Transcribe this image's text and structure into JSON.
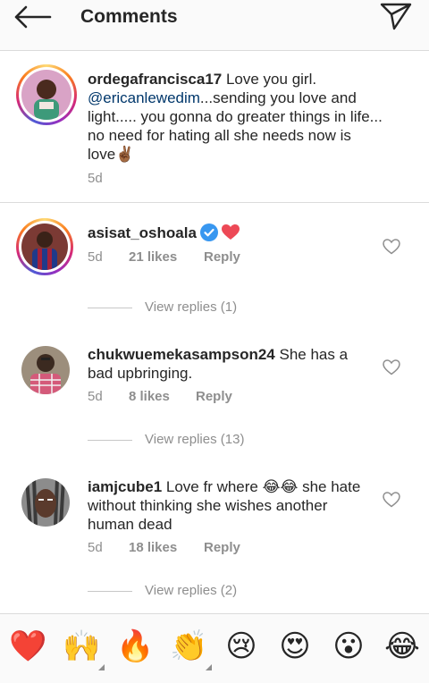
{
  "header": {
    "title": "Comments",
    "back_icon": "arrow-left-icon",
    "send_icon": "paper-plane-icon"
  },
  "caption": {
    "username": "ordegafrancisca17",
    "text_before_mention": " Love you girl.",
    "mention": "@ericanlewedim",
    "text_after_mention": "...sending you love and light..... you gonna do greater things in life... no need for hating all she needs now is love",
    "emoji": "✌🏾",
    "time": "5d"
  },
  "comments": [
    {
      "username": "asisat_oshoala",
      "verified": true,
      "text": "",
      "time": "5d",
      "likes": "21 likes",
      "reply": "Reply",
      "view_replies": "View replies (1)"
    },
    {
      "username": "chukwuemekasampson24",
      "text": " She has a bad upbringing.",
      "time": "5d",
      "likes": "8 likes",
      "reply": "Reply",
      "view_replies": "View replies (13)"
    },
    {
      "username": "iamjcube1",
      "text_a": " Love fr where ",
      "emoji": "😂😂",
      "text_b": " she hate without thinking she wishes another human dead",
      "time": "5d",
      "likes": "18 likes",
      "reply": "Reply",
      "view_replies": "View replies (2)"
    }
  ],
  "emoji_bar": [
    "❤️",
    "🙌",
    "🔥",
    "👏",
    "😢",
    "😍",
    "😮",
    "😂"
  ],
  "colors": {
    "mention": "#00376b",
    "meta": "#8e8e8e",
    "verified": "#3897f0",
    "heart": "#ed4956"
  }
}
